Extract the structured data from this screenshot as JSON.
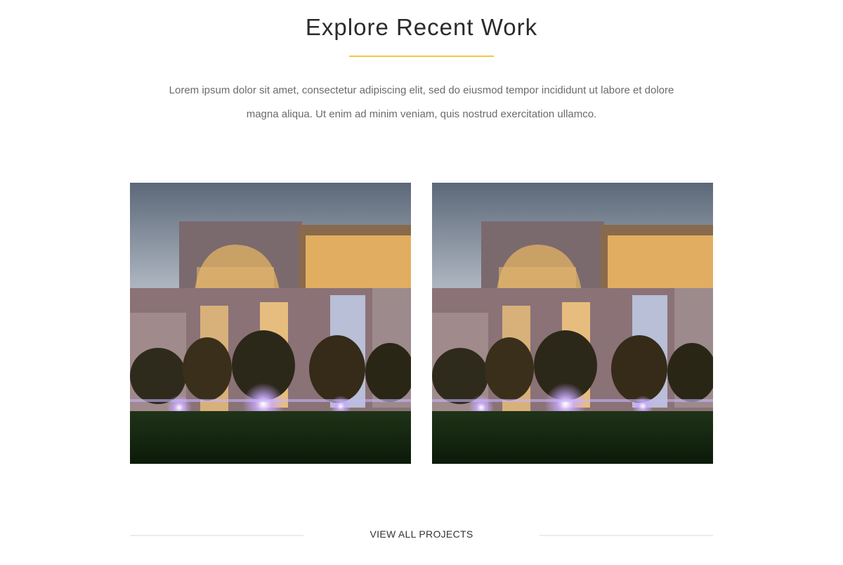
{
  "section": {
    "title": "Explore Recent Work",
    "intro_line1": "Lorem ipsum dolor sit amet, consectetur adipiscing elit, sed do eiusmod tempor incididunt ut labore et dolore",
    "intro_line2": "magna aliqua. Ut enim ad minim veniam, quis nostrud exercitation ullamco."
  },
  "projects": [
    {
      "image": "building-night-photo"
    },
    {
      "image": "building-night-photo"
    }
  ],
  "footer": {
    "view_all_label": "VIEW ALL PROJECTS"
  },
  "colors": {
    "accent": "#f5c542",
    "heading": "#2b2b2b",
    "body_text": "#6b6b6b",
    "divider": "#ececec"
  }
}
